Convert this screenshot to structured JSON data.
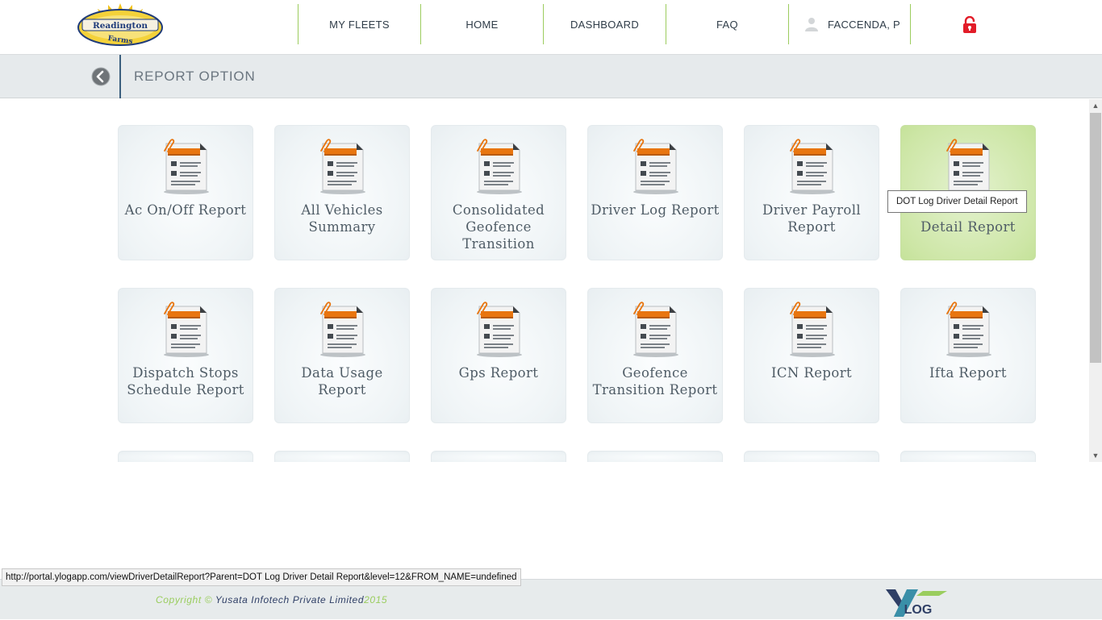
{
  "header": {
    "logo": {
      "line1": "Readington",
      "line2": "Farms"
    },
    "nav": [
      {
        "label": "MY FLEETS"
      },
      {
        "label": "HOME"
      },
      {
        "label": "DASHBOARD"
      },
      {
        "label": "FAQ"
      }
    ],
    "user": {
      "name": "FACCENDA, P",
      "icon": "user-icon"
    },
    "logout_icon": "lock-icon",
    "colors": {
      "nav_divider": "#9ccc5e",
      "logout": "#e21c28"
    }
  },
  "subheader": {
    "back_icon": "chevron-left-icon",
    "title": "REPORT OPTION"
  },
  "reports": {
    "tiles": [
      {
        "label": "Ac On/Off Report"
      },
      {
        "label": "All Vehicles Summary"
      },
      {
        "label": "Consolidated Geofence Transition"
      },
      {
        "label": "Driver Log Report"
      },
      {
        "label": "Driver Payroll Report"
      },
      {
        "label": "Detail Report",
        "active": true
      },
      {
        "label": "Dispatch Stops Schedule Report"
      },
      {
        "label": "Data Usage Report"
      },
      {
        "label": "Gps Report"
      },
      {
        "label": "Geofence Transition Report"
      },
      {
        "label": "ICN Report"
      },
      {
        "label": "Ifta Report"
      }
    ],
    "tile_icon": "report-document-icon",
    "colors": {
      "tile_hover": "#cde6a6",
      "icon_header": "#e8750f"
    }
  },
  "tooltip": {
    "text": "DOT Log Driver Detail Report"
  },
  "statusbar": {
    "url": "http://portal.ylogapp.com/viewDriverDetailReport?Parent=DOT Log Driver Detail Report&level=12&FROM_NAME=undefined"
  },
  "footer": {
    "copyright_prefix": "Copyright ©",
    "company": "Yusata Infotech Private Limited",
    "year": "2015",
    "logo_text": "LOG"
  }
}
